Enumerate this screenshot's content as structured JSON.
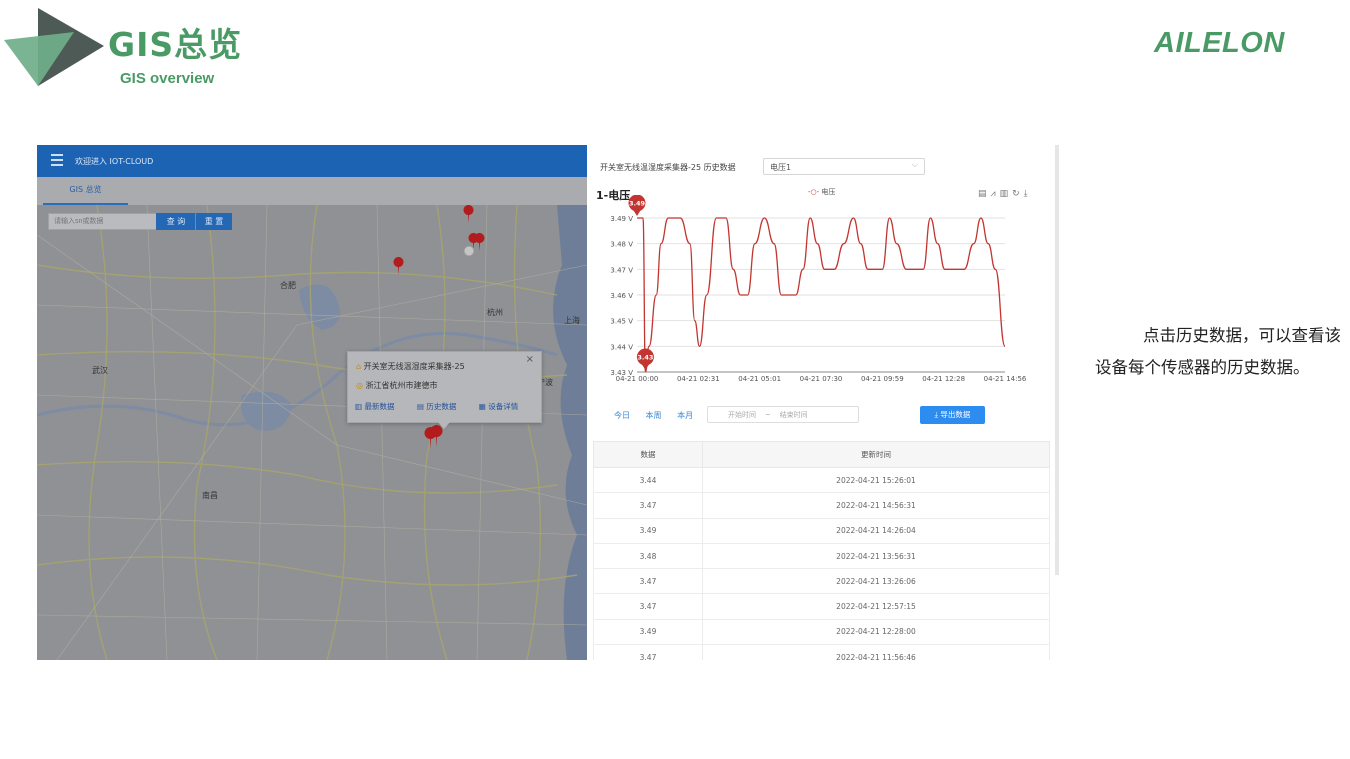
{
  "slide": {
    "title": "GIS总览",
    "subtitle": "GIS overview",
    "brand": "AILELON",
    "description": "点击历史数据，可以查看该设备每个传感器的历史数据。"
  },
  "map": {
    "welcome": "欢迎进入 IOT-CLOUD",
    "tab": "GIS 总览",
    "search_placeholder": "请输入sn或数据",
    "query_label": "查 询",
    "reset_label": "重 置",
    "city_labels": [
      "合肥",
      "武汉",
      "上海",
      "南昌",
      "杭州",
      "宁波"
    ],
    "popup": {
      "device": "开关室无线温湿度采集器-25",
      "location": "浙江省杭州市建德市",
      "actions": [
        "最新数据",
        "历史数据",
        "设备详情"
      ],
      "close": "×"
    }
  },
  "history": {
    "title": "开关室无线温湿度采集器-25 历史数据",
    "channel": "电压1",
    "quick_ranges": [
      "今日",
      "本周",
      "本月"
    ],
    "start_placeholder": "开始时间",
    "range_sep": "~",
    "end_placeholder": "结束时间",
    "export_label": "导出数据",
    "table": {
      "headers": [
        "数据",
        "更新时间"
      ],
      "rows": [
        [
          "3.44",
          "2022-04-21 15:26:01"
        ],
        [
          "3.47",
          "2022-04-21 14:56:31"
        ],
        [
          "3.49",
          "2022-04-21 14:26:04"
        ],
        [
          "3.48",
          "2022-04-21 13:56:31"
        ],
        [
          "3.47",
          "2022-04-21 13:26:06"
        ],
        [
          "3.47",
          "2022-04-21 12:57:15"
        ],
        [
          "3.49",
          "2022-04-21 12:28:00"
        ],
        [
          "3.47",
          "2022-04-21 11:56:46"
        ]
      ]
    }
  },
  "chart_data": {
    "type": "line",
    "title": "1-电压",
    "legend": [
      "电压"
    ],
    "legend_position": "top-center",
    "ylim": [
      3.43,
      3.49
    ],
    "y_ticks": [
      "3.43 V",
      "3.44 V",
      "3.45 V",
      "3.46 V",
      "3.47 V",
      "3.48 V",
      "3.49 V"
    ],
    "x_ticks": [
      "04-21 00:00",
      "04-21 02:31",
      "04-21 05:01",
      "04-21 07:30",
      "04-21 09:59",
      "04-21 12:28",
      "04-21 14:56"
    ],
    "grid": true,
    "color": "#c23531",
    "markers": [
      {
        "label": "3.49",
        "x": 0,
        "y": 3.49
      },
      {
        "label": "3.43",
        "x": 0.35,
        "y": 3.43
      }
    ],
    "series": [
      {
        "name": "电压",
        "x": [
          0,
          0.25,
          0.35,
          0.5,
          0.8,
          1.0,
          1.3,
          1.8,
          2.2,
          2.4,
          2.6,
          2.9,
          3.3,
          3.7,
          4.0,
          4.3,
          4.6,
          4.9,
          5.3,
          5.7,
          6.0,
          6.3,
          6.6,
          6.9,
          7.2,
          7.5,
          7.8,
          8.2,
          8.6,
          9.0,
          9.3,
          9.6,
          9.9,
          10.2,
          10.5,
          10.8,
          11.2,
          11.6,
          11.9,
          12.2,
          12.5,
          12.8,
          13.2,
          13.6,
          14.0,
          14.3,
          14.6,
          14.9,
          15.3
        ],
        "values": [
          3.49,
          3.49,
          3.43,
          3.44,
          3.46,
          3.48,
          3.49,
          3.49,
          3.48,
          3.45,
          3.44,
          3.46,
          3.49,
          3.49,
          3.47,
          3.46,
          3.46,
          3.48,
          3.49,
          3.48,
          3.46,
          3.46,
          3.46,
          3.47,
          3.49,
          3.48,
          3.47,
          3.47,
          3.48,
          3.49,
          3.48,
          3.47,
          3.47,
          3.47,
          3.49,
          3.48,
          3.47,
          3.47,
          3.47,
          3.49,
          3.48,
          3.47,
          3.47,
          3.47,
          3.48,
          3.49,
          3.48,
          3.47,
          3.44
        ]
      }
    ]
  },
  "colors": {
    "brand_green": "#4a9a66",
    "topbar_blue": "#1c63b4",
    "button_blue": "#2d8cf0",
    "line_red": "#c23531"
  }
}
